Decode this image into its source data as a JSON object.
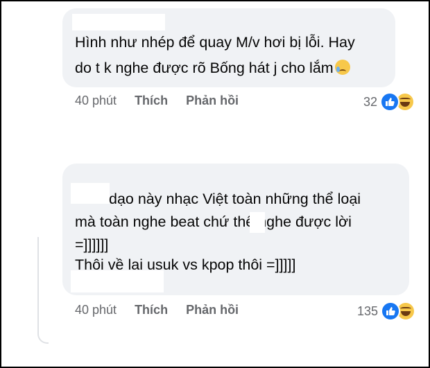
{
  "comments": [
    {
      "lines": [
        "Hình như nhép để quay M/v hơi bị lỗi. Hay",
        "do t k nghe được rõ Bống hát j cho lắm"
      ],
      "time": "40 phút",
      "like_label": "Thích",
      "reply_label": "Phản hồi",
      "reaction_count": "32",
      "reaction_icons": [
        "like-icon",
        "haha-icon"
      ],
      "emoji": "crying-face"
    },
    {
      "lines": [
        "dạo này nhạc Việt toàn những thể loại",
        "mà toàn nghe beat chứ     thể nghe được lời",
        "=]]]]]]",
        "Thôi về lại usuk vs kpop thôi =]]]]]"
      ],
      "time": "40 phút",
      "like_label": "Thích",
      "reply_label": "Phản hồi",
      "reaction_count": "135",
      "reaction_icons": [
        "like-icon",
        "haha-icon"
      ]
    }
  ],
  "colors": {
    "bubble_bg": "#f0f2f5",
    "text": "#050505",
    "meta_text": "#65676b",
    "like_blue": "#1877f2",
    "haha_yellow": "#f7c84b"
  }
}
